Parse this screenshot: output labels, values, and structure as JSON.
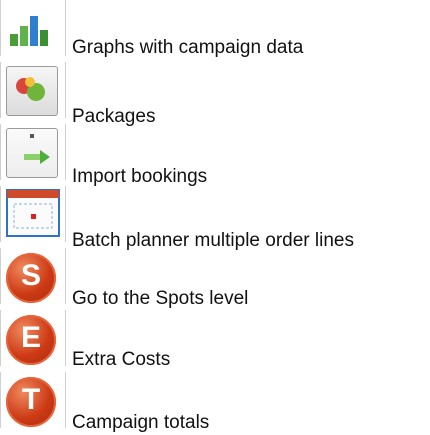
{
  "items": [
    {
      "label": "Graphs with campaign data",
      "icon": "bar-chart-icon"
    },
    {
      "label": "Packages",
      "icon": "packages-icon"
    },
    {
      "label": "Import bookings",
      "icon": "import-icon"
    },
    {
      "label": "Batch planner multiple order lines",
      "icon": "batch-planner-icon"
    },
    {
      "label": "Go to the Spots level",
      "icon": "spots-level-icon",
      "letter": "S"
    },
    {
      "label": "Extra Costs",
      "icon": "extra-costs-icon",
      "letter": "E"
    },
    {
      "label": "Campaign totals",
      "icon": "campaign-totals-icon",
      "letter": "T"
    }
  ]
}
